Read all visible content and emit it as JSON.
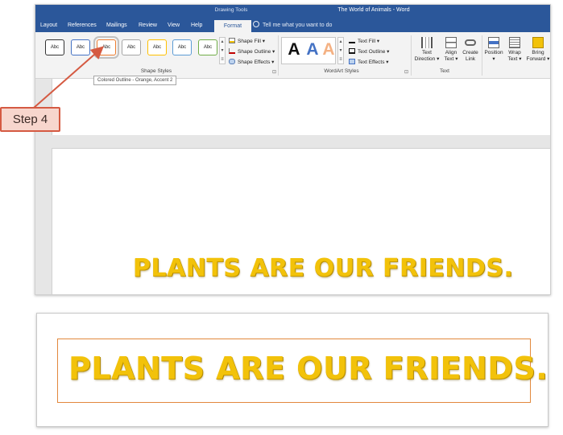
{
  "window": {
    "contextual_tab_group": "Drawing Tools",
    "title": "The World of Animals  -  Word",
    "tabs": [
      "Layout",
      "References",
      "Mailings",
      "Review",
      "View",
      "Help",
      "Format"
    ],
    "active_tab": "Format",
    "search_placeholder": "Tell me what you want to do"
  },
  "ribbon": {
    "shape_styles": {
      "items": [
        {
          "label": "Abc",
          "outline": "#333333"
        },
        {
          "label": "Abc",
          "outline": "#4472c4"
        },
        {
          "label": "Abc",
          "outline": "#ed7d31"
        },
        {
          "label": "Abc",
          "outline": "#a5a5a5"
        },
        {
          "label": "Abc",
          "outline": "#ffc000"
        },
        {
          "label": "Abc",
          "outline": "#5b9bd5"
        },
        {
          "label": "Abc",
          "outline": "#70ad47"
        }
      ],
      "commands": [
        "Shape Fill",
        "Shape Outline",
        "Shape Effects"
      ],
      "group_label": "Shape Styles"
    },
    "wordart_styles": {
      "letters": [
        {
          "glyph": "A",
          "color": "#111111"
        },
        {
          "glyph": "A",
          "color": "#4472c4"
        },
        {
          "glyph": "A",
          "color": "#f4b183"
        }
      ],
      "commands": [
        "Text Fill",
        "Text Outline",
        "Text Effects"
      ],
      "group_label": "WordArt Styles"
    },
    "text_group": {
      "buttons": [
        {
          "line1": "Text",
          "line2": "Direction"
        },
        {
          "line1": "Align",
          "line2": "Text"
        },
        {
          "line1": "Create",
          "line2": "Link"
        }
      ],
      "group_label": "Text"
    },
    "arrange": {
      "buttons": [
        {
          "line1": "Position",
          "line2": ""
        },
        {
          "line1": "Wrap",
          "line2": "Text"
        },
        {
          "line1": "Bring",
          "line2": "Forward"
        }
      ]
    }
  },
  "tooltip": "Colored Outline - Orange, Accent 2",
  "callout": {
    "label": "Step 4",
    "color": "#d55a42"
  },
  "document": {
    "wordart_text": "PLANTS ARE OUR FRIENDS."
  },
  "result": {
    "wordart_text": "PLANTS ARE OUR FRIENDS.",
    "outline_color": "#e2883c"
  }
}
